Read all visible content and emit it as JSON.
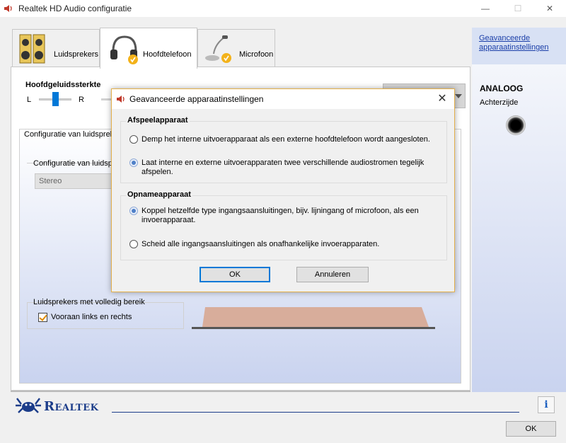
{
  "window": {
    "title": "Realtek HD Audio configuratie",
    "minimize": "—",
    "maximize": "☐",
    "close": "✕"
  },
  "tabs": [
    {
      "label": "Luidsprekers"
    },
    {
      "label": "Hoofdtelefoon"
    },
    {
      "label": "Microfoon"
    }
  ],
  "right_panel": {
    "link_line1": "Geavanceerde",
    "link_line2": "apparaatinstellingen",
    "connector_title": "ANALOOG",
    "connector_sub": "Achterzijde"
  },
  "volume": {
    "title": "Hoofdgeluidssterkte",
    "left": "L",
    "right": "R",
    "level": 0.42
  },
  "config": {
    "tab_title": "Configuratie van luidspreke",
    "sub_title": "Configuratie van luidsp",
    "selected": "Stereo",
    "fullrange_title": "Luidsprekers met volledig bereik",
    "fullrange_checkbox": "Vooraan links en rechts"
  },
  "footer": {
    "brand": "Realtek",
    "info": "i",
    "ok": "OK"
  },
  "dialog": {
    "title": "Geavanceerde apparaatinstellingen",
    "close": "✕",
    "playback_title": "Afspeelapparaat",
    "playback_opt1": "Demp het interne uitvoerapparaat als een externe hoofdtelefoon wordt aangesloten.",
    "playback_opt2": "Laat interne en externe uitvoerapparaten twee verschillende audiostromen tegelijk afspelen.",
    "recording_title": "Opnameapparaat",
    "recording_opt1": "Koppel hetzelfde type ingangsaansluitingen, bijv. lijningang of microfoon, als een invoerapparaat.",
    "recording_opt2": "Scheid alle ingangsaansluitingen als onafhankelijke invoerapparaten.",
    "ok": "OK",
    "cancel": "Annuleren"
  },
  "colors": {
    "accent": "#0078d7",
    "link": "#1a3ea8",
    "brand": "#1c3d8a",
    "dialog_border": "#e4b04a"
  }
}
